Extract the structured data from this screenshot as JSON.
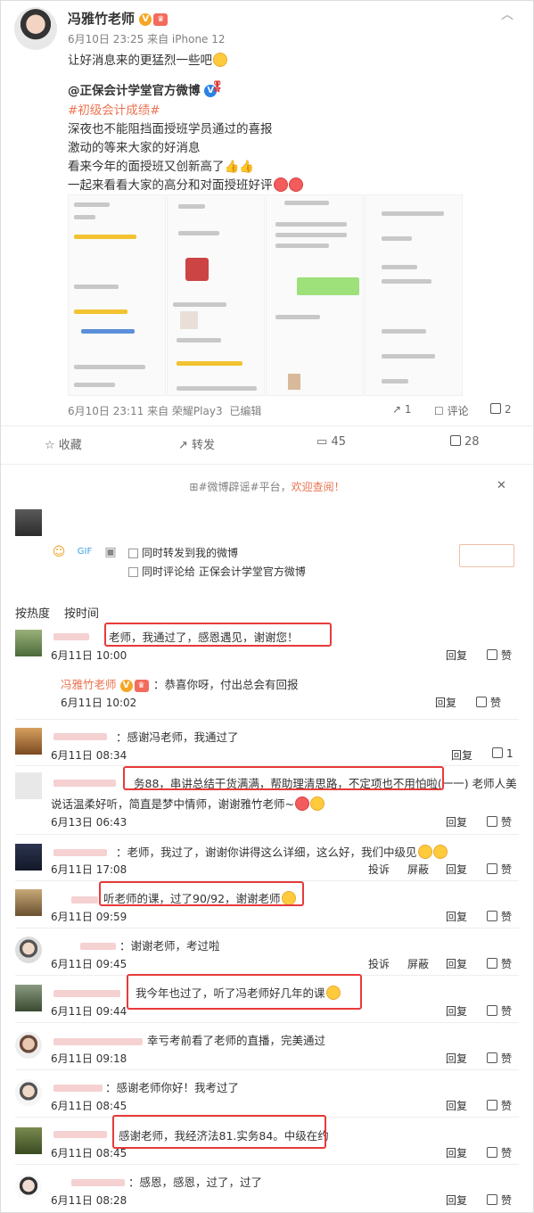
{
  "post": {
    "author": "冯雅竹老师",
    "meta": "6月10日 23:25 来自 iPhone 12",
    "text": "让好消息来的更猛烈一些吧"
  },
  "repost": {
    "author": "@正保会计学堂官方微博",
    "hashtag": "#初级会计成绩#",
    "lines": [
      "深夜也不能阻挡面授班学员通过的喜报",
      "激动的等来大家的好消息",
      "看来今年的面授班又创新高了",
      "一起来看看大家的高分和对面授班好评"
    ],
    "meta": "6月10日 23:11 来自 荣耀Play3",
    "edited": "已编辑",
    "share_count": "1",
    "comment_label": "评论",
    "like_count": "2"
  },
  "actions": {
    "favorite": "收藏",
    "forward": "转发",
    "comments": "45",
    "likes": "28"
  },
  "notice": {
    "text": "#微博辟谣#平台，",
    "link": "欢迎查阅！"
  },
  "compose": {
    "option1": "同时转发到我的微博",
    "option2": "同时评论给 正保会计学堂官方微博"
  },
  "sort": {
    "hot": "按热度",
    "time": "按时间"
  },
  "labels": {
    "reply": "回复",
    "like": "赞",
    "report": "投诉",
    "block": "屏蔽"
  },
  "comments": [
    {
      "text": "老师，我通过了，感恩遇见，谢谢您！",
      "time": "6月11日 10:00"
    },
    {
      "author": "冯雅竹老师",
      "text": "：恭喜你呀，付出总会有回报",
      "time": "6月11日 10:02"
    },
    {
      "text": "：感谢冯老师，我通过了",
      "time": "6月11日 08:34",
      "likes": "1"
    },
    {
      "text": "务88，串讲总结干货满满，帮助理清思路，不定项也不用怕啦(一一) 老师人美",
      "text2": "说话温柔好听，简直是梦中情师，谢谢雅竹老师~",
      "time": "6月13日 06:43"
    },
    {
      "text": "：老师，我过了，谢谢你讲得这么详细，这么好，我们中级见",
      "time": "6月11日 17:08"
    },
    {
      "text": "听老师的课，过了90/92，谢谢老师",
      "time": "6月11日 09:59"
    },
    {
      "text": "：谢谢老师，考过啦",
      "time": "6月11日 09:45"
    },
    {
      "text": "我今年也过了，听了冯老师好几年的课",
      "time": "6月11日 09:44"
    },
    {
      "text": "幸亏考前看了老师的直播，完美通过",
      "time": "6月11日 09:18"
    },
    {
      "text": "：感谢老师你好！我考过了",
      "time": "6月11日 08:45"
    },
    {
      "text": "感谢老师，我经济法81.实务84。中级在约",
      "time": "6月11日 08:45"
    },
    {
      "text": "：感恩，感恩，过了，过了",
      "time": "6月11日 08:28"
    }
  ]
}
